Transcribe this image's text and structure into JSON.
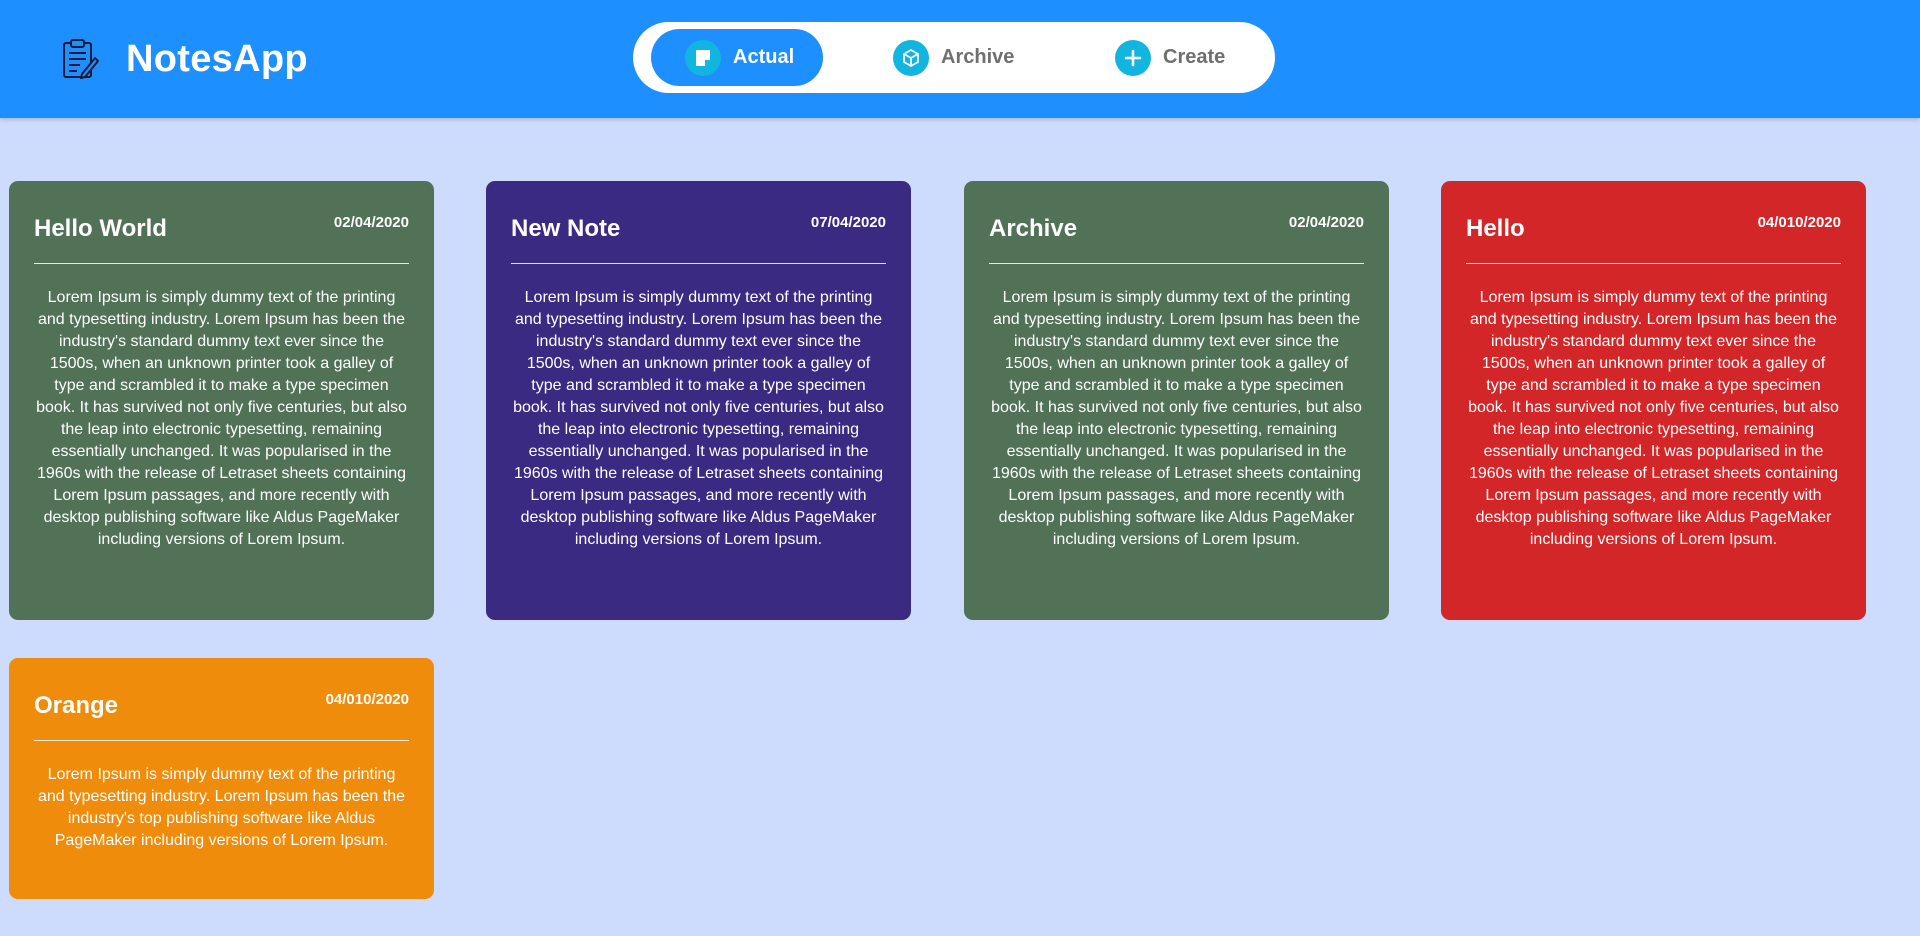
{
  "app": {
    "title": "NotesApp"
  },
  "nav": {
    "items": [
      {
        "label": "Actual",
        "icon": "sticky-note-icon",
        "active": true
      },
      {
        "label": "Archive",
        "icon": "cube-icon",
        "active": false
      },
      {
        "label": "Create",
        "icon": "plus-icon",
        "active": false
      }
    ]
  },
  "colors": {
    "header": "#1e8ffe",
    "background": "#cddcfd",
    "nav_icon": "#12b5e0",
    "green": "#527258",
    "purple": "#3b2a82",
    "red": "#d32628",
    "orange": "#f08c0c"
  },
  "notes": [
    {
      "title": "Hello World",
      "date": "02/04/2020",
      "color": "green",
      "body": "Lorem Ipsum is simply dummy text of the printing and typesetting industry. Lorem Ipsum has been the industry's standard dummy text ever since the 1500s, when an unknown printer took a galley of type and scrambled it to make a type specimen book. It has survived not only five centuries, but also the leap into electronic typesetting, remaining essentially unchanged. It was popularised in the 1960s with the release of Letraset sheets containing Lorem Ipsum passages, and more recently with desktop publishing software like Aldus PageMaker including versions of Lorem Ipsum."
    },
    {
      "title": "New Note",
      "date": "07/04/2020",
      "color": "purple",
      "body": "Lorem Ipsum is simply dummy text of the printing and typesetting industry. Lorem Ipsum has been the industry's standard dummy text ever since the 1500s, when an unknown printer took a galley of type and scrambled it to make a type specimen book. It has survived not only five centuries, but also the leap into electronic typesetting, remaining essentially unchanged. It was popularised in the 1960s with the release of Letraset sheets containing Lorem Ipsum passages, and more recently with desktop publishing software like Aldus PageMaker including versions of Lorem Ipsum."
    },
    {
      "title": "Archive",
      "date": "02/04/2020",
      "color": "green",
      "body": "Lorem Ipsum is simply dummy text of the printing and typesetting industry. Lorem Ipsum has been the industry's standard dummy text ever since the 1500s, when an unknown printer took a galley of type and scrambled it to make a type specimen book. It has survived not only five centuries, but also the leap into electronic typesetting, remaining essentially unchanged. It was popularised in the 1960s with the release of Letraset sheets containing Lorem Ipsum passages, and more recently with desktop publishing software like Aldus PageMaker including versions of Lorem Ipsum."
    },
    {
      "title": "Hello",
      "date": "04/010/2020",
      "color": "red",
      "body": "Lorem Ipsum is simply dummy text of the printing and typesetting industry. Lorem Ipsum has been the industry's standard dummy text ever since the 1500s, when an unknown printer took a galley of type and scrambled it to make a type specimen book. It has survived not only five centuries, but also the leap into electronic typesetting, remaining essentially unchanged. It was popularised in the 1960s with the release of Letraset sheets containing Lorem Ipsum passages, and more recently with desktop publishing software like Aldus PageMaker including versions of Lorem Ipsum."
    },
    {
      "title": "Orange",
      "date": "04/010/2020",
      "color": "orange",
      "body": "Lorem Ipsum is simply dummy text of the printing and typesetting industry. Lorem Ipsum has been the industry's top publishing software like Aldus PageMaker including versions of Lorem Ipsum."
    }
  ]
}
